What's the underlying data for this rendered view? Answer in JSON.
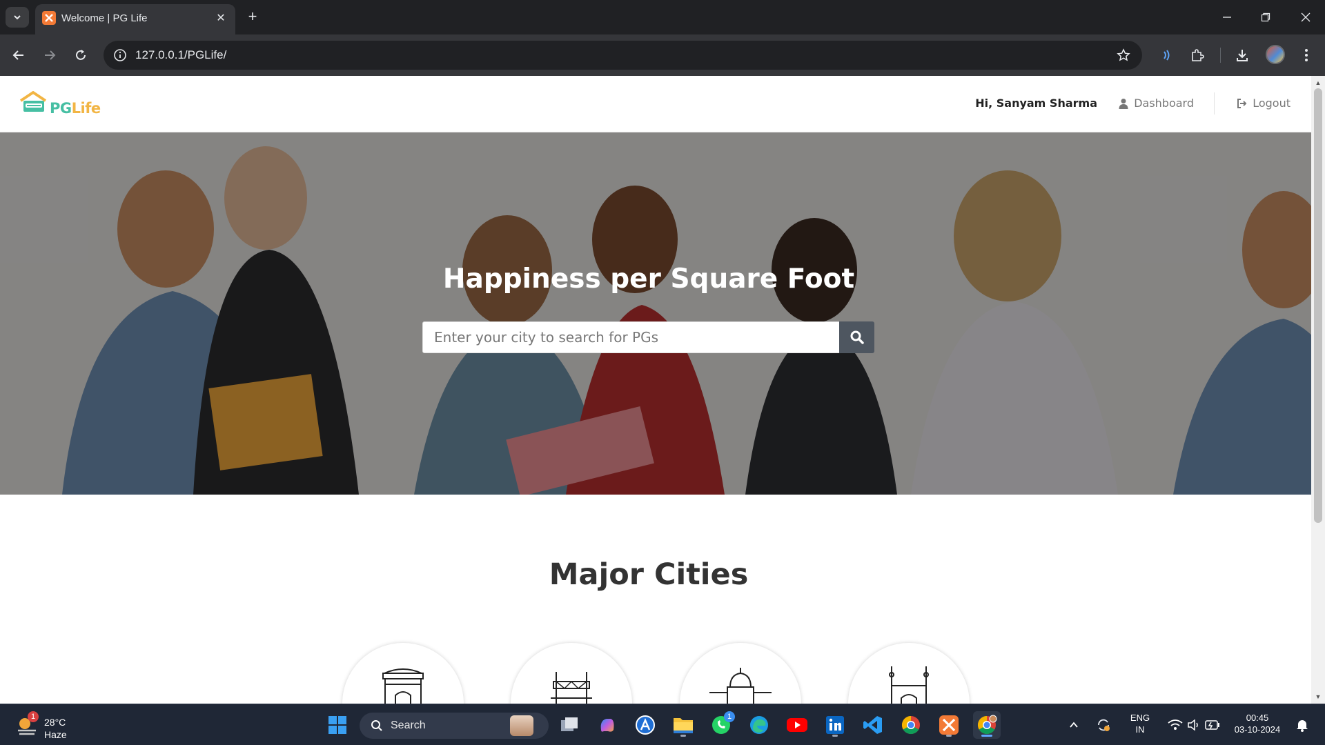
{
  "browser": {
    "tab": {
      "title": "Welcome | PG Life"
    },
    "address": {
      "url": "127.0.0.1/PGLife/"
    }
  },
  "site": {
    "logo": {
      "pg": "PG",
      "life": "Life"
    },
    "nav": {
      "greeting": "Hi, Sanyam Sharma",
      "dashboard": "Dashboard",
      "logout": "Logout"
    },
    "hero": {
      "title": "Happiness per Square Foot",
      "search_placeholder": "Enter your city to search for PGs"
    },
    "major_cities": {
      "title": "Major Cities",
      "cities": [
        {
          "icon": "india-gate-icon"
        },
        {
          "icon": "howrah-bridge-icon"
        },
        {
          "icon": "mosque-dome-icon"
        },
        {
          "icon": "charminar-icon"
        }
      ]
    }
  },
  "taskbar": {
    "weather": {
      "temp": "28°C",
      "condition": "Haze",
      "badge": "1"
    },
    "search_label": "Search",
    "whatsapp_badge": "1",
    "language": {
      "line1": "ENG",
      "line2": "IN"
    },
    "clock": {
      "time": "00:45",
      "date": "03-10-2024"
    }
  },
  "colors": {
    "logo_pg": "#46bfa3",
    "logo_life": "#f2b544",
    "search_button": "#4e5660",
    "taskbar": "#1f2736"
  }
}
